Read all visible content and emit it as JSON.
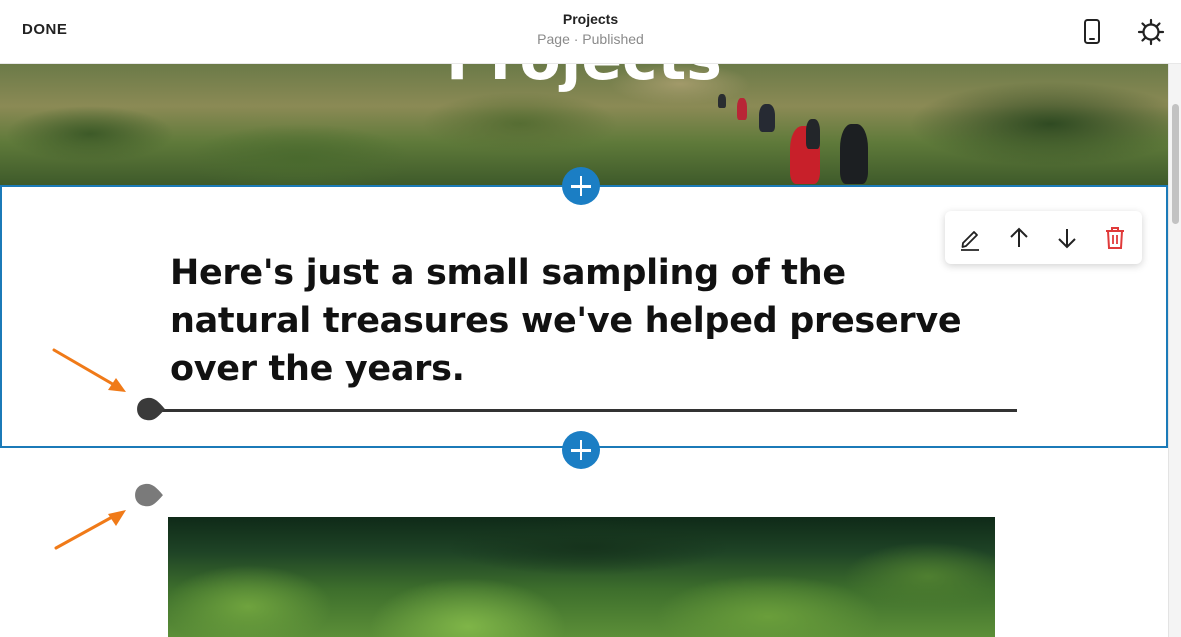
{
  "topbar": {
    "done_label": "DONE",
    "page_title": "Projects",
    "page_subtitle": "Page · Published",
    "icons": [
      "mobile-preview-icon",
      "gear-icon"
    ]
  },
  "hero": {
    "title": "Projects"
  },
  "section": {
    "headline": "Here's just a small sampling of the natural treasures we've helped preserve over the years.",
    "toolbar": [
      "pencil-icon",
      "arrow-up-icon",
      "arrow-down-icon",
      "trash-icon"
    ]
  },
  "colors": {
    "accent": "#1b7ec4",
    "section_border": "#1b7ab8",
    "delete": "#e03a3a",
    "annotation_arrow": "#f07a18",
    "handle": "#3a3a3a"
  }
}
